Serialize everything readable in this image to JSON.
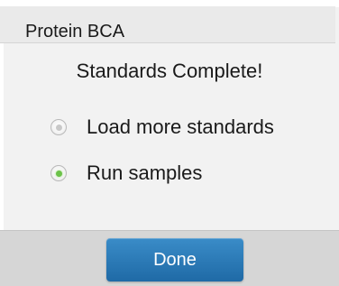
{
  "dialog": {
    "title": "Protein BCA",
    "message": "Standards Complete!",
    "options": [
      {
        "label": "Load more standards",
        "selected": false
      },
      {
        "label": "Run samples",
        "selected": true
      }
    ],
    "done_label": "Done"
  },
  "colors": {
    "accent_button": "#2a7bb8",
    "radio_selected": "#6cc24a",
    "dialog_background": "#f2f2f2",
    "footer_background": "#d6d6d6"
  }
}
